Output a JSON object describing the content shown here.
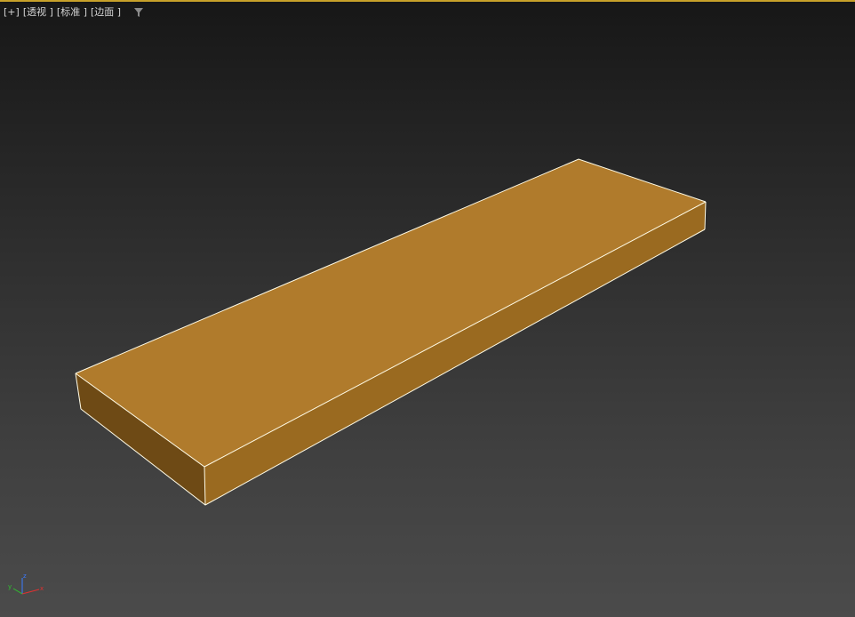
{
  "viewport": {
    "labels": {
      "menu": "[+]",
      "view": "[透视 ]",
      "shading": "[标准 ]",
      "display": "[边面 ]"
    },
    "icons": {
      "filter": "filter-icon"
    }
  },
  "scene": {
    "object": "box",
    "colors": {
      "top_face": "#b07b2c",
      "front_face": "#9a6a20",
      "side_face": "#6e4a15",
      "edges": "#fffbe6"
    }
  },
  "axis_gizmo": {
    "x_label": "x",
    "y_label": "y",
    "z_label": "z",
    "colors": {
      "x": "#e03030",
      "y": "#30c030",
      "z": "#3a7bff"
    }
  }
}
